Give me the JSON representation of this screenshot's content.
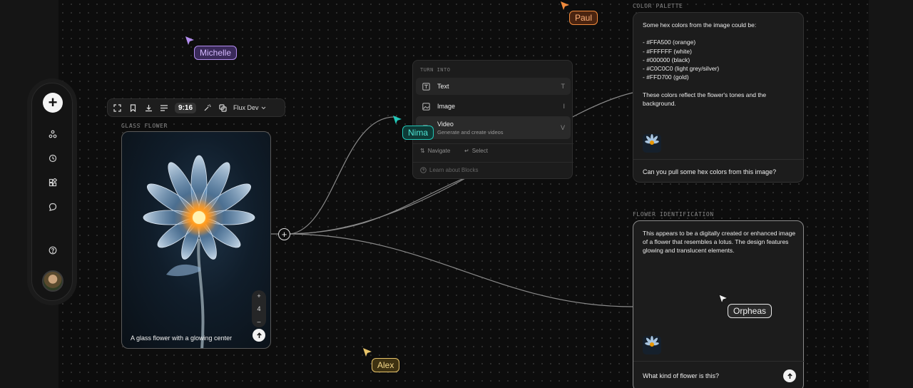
{
  "left_rail": {
    "items": [
      {
        "name": "add",
        "icon": "plus-icon"
      },
      {
        "name": "flows",
        "icon": "nodes-icon"
      },
      {
        "name": "history",
        "icon": "history-icon"
      },
      {
        "name": "blocks",
        "icon": "blocks-icon"
      },
      {
        "name": "chat",
        "icon": "chat-icon"
      },
      {
        "name": "help",
        "icon": "help-icon"
      }
    ]
  },
  "image_node": {
    "label": "GLASS FLOWER",
    "caption": "A glass flower with a glowing center",
    "zoom": {
      "plus": "+",
      "value": "4",
      "minus": "–"
    },
    "toolbar": {
      "ratio": "9:16",
      "model": "Flux Dev"
    }
  },
  "turn_into_menu": {
    "heading": "TURN INTO",
    "items": [
      {
        "label": "Text",
        "shortcut": "T",
        "icon": "text-icon"
      },
      {
        "label": "Image",
        "shortcut": "I",
        "icon": "image-icon"
      },
      {
        "label": "Video",
        "sublabel": "Generate and create videos",
        "shortcut": "V",
        "icon": "video-icon"
      }
    ],
    "navigate": "Navigate",
    "select": "Select",
    "learn": "Learn about Blocks"
  },
  "cursors": [
    {
      "name": "Michelle",
      "color": "#b48ef0"
    },
    {
      "name": "Paul",
      "color": "#f08a3c"
    },
    {
      "name": "Nima",
      "color": "#22c7b8"
    },
    {
      "name": "Alex",
      "color": "#e8c46a"
    },
    {
      "name": "Orpheas",
      "color": "#e8e8e8"
    }
  ],
  "color_palette": {
    "label": "COLOR PALETTE",
    "response": "Some hex colors from the image could be:\n\n- #FFA500 (orange)\n- #FFFFFF (white)\n- #000000 (black)\n- #C0C0C0 (light grey/silver)\n- #FFD700 (gold)\n\nThese colors reflect the flower's tones and the background.",
    "prompt": "Can you pull some hex colors from this image?"
  },
  "flower_identification": {
    "label": "FLOWER IDENTIFICATION",
    "response": "This appears to be a digitally created or enhanced image of a flower that resembles a lotus. The design features glowing and translucent elements.",
    "prompt": "What kind of flower is this?"
  }
}
